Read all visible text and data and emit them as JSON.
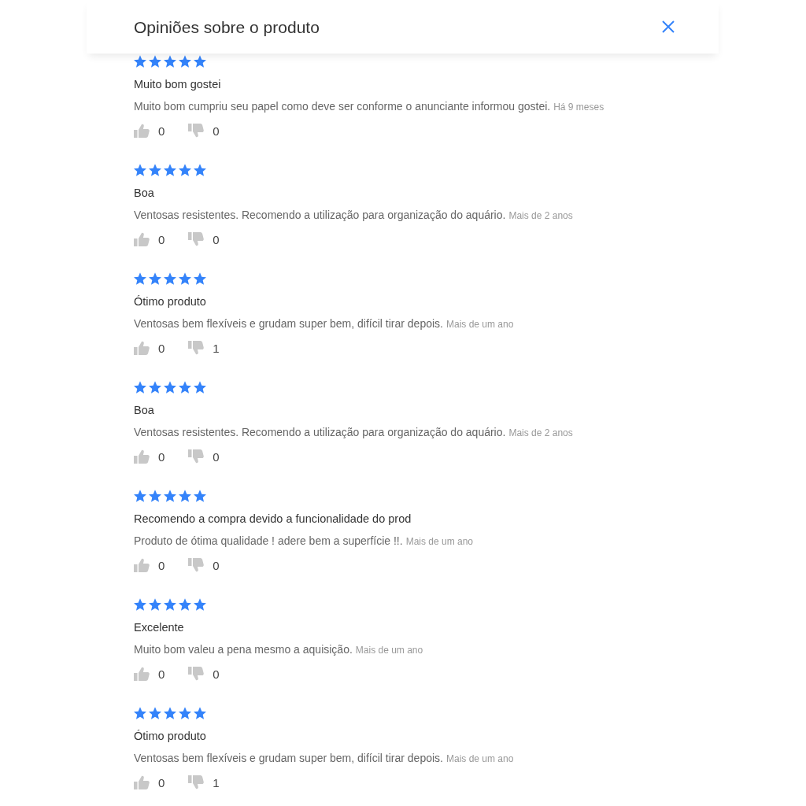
{
  "dialog": {
    "title": "Opiniões sobre o produto"
  },
  "reviews": [
    {
      "stars": 5,
      "title": "Muito bom gostei",
      "body": "Muito bom cumpriu seu papel como deve ser conforme o anunciante informou gostei.",
      "date": "Há 9 meses",
      "likes": "0",
      "dislikes": "0"
    },
    {
      "stars": 5,
      "title": "Boa",
      "body": "Ventosas resistentes. Recomendo a utilização para organização do aquário.",
      "date": "Mais de 2 anos",
      "likes": "0",
      "dislikes": "0"
    },
    {
      "stars": 5,
      "title": "Ótimo produto",
      "body": "Ventosas bem flexíveis e grudam super bem, difícil tirar depois.",
      "date": "Mais de um ano",
      "likes": "0",
      "dislikes": "1"
    },
    {
      "stars": 5,
      "title": "Boa",
      "body": "Ventosas resistentes. Recomendo a utilização para organização do aquário.",
      "date": "Mais de 2 anos",
      "likes": "0",
      "dislikes": "0"
    },
    {
      "stars": 5,
      "title": "Recomendo a compra devido a funcionalidade do prod",
      "body": "Produto de ótima qualidade ! adere bem a superfície !!.",
      "date": "Mais de um ano",
      "likes": "0",
      "dislikes": "0"
    },
    {
      "stars": 5,
      "title": "Excelente",
      "body": "Muito bom valeu a pena mesmo a aquisição.",
      "date": "Mais de um ano",
      "likes": "0",
      "dislikes": "0"
    },
    {
      "stars": 5,
      "title": "Ótimo produto",
      "body": "Ventosas bem flexíveis e grudam super bem, difícil tirar depois.",
      "date": "Mais de um ano",
      "likes": "0",
      "dislikes": "1"
    }
  ]
}
